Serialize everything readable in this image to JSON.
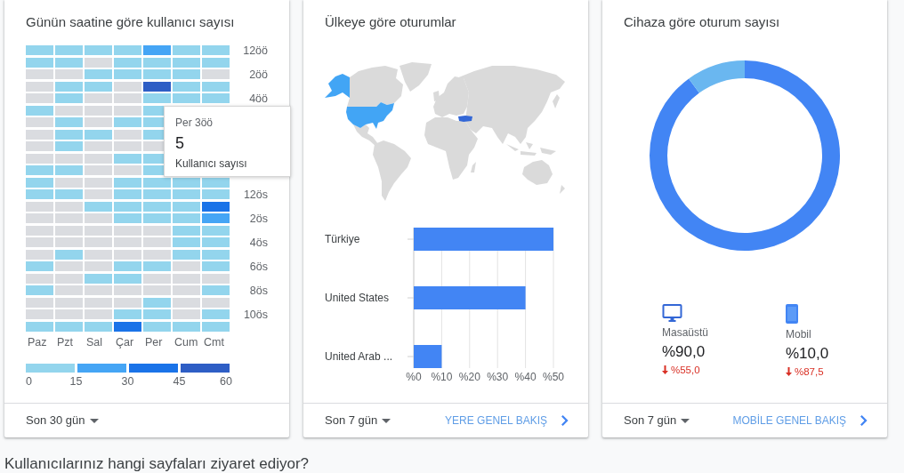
{
  "hourly_users": {
    "title": "Günün saatine göre kullanıcı sayısı",
    "rows": [
      {
        "label": "12öö",
        "cells": [
          {
            "kind": "low"
          },
          {
            "kind": "low"
          },
          {
            "kind": "low"
          },
          {
            "kind": "low"
          },
          {
            "kind": "mid"
          },
          {
            "kind": "low"
          },
          {
            "kind": "low"
          }
        ]
      },
      {
        "cells": [
          {
            "kind": "low"
          },
          {
            "kind": "low"
          },
          {
            "kind": "zero"
          },
          {
            "kind": "low"
          },
          {
            "kind": "low"
          },
          {
            "kind": "low"
          },
          {
            "kind": "low"
          }
        ]
      },
      {
        "label": "2öö",
        "cells": [
          {
            "kind": "zero"
          },
          {
            "kind": "zero"
          },
          {
            "kind": "low"
          },
          {
            "kind": "low"
          },
          {
            "kind": "low"
          },
          {
            "kind": "low"
          },
          {
            "kind": "zero"
          }
        ]
      },
      {
        "cells": [
          {
            "kind": "zero"
          },
          {
            "kind": "low"
          },
          {
            "kind": "low"
          },
          {
            "kind": "zero"
          },
          {
            "kind": "top"
          },
          {
            "kind": "low"
          },
          {
            "kind": "low"
          }
        ]
      },
      {
        "label": "4öö",
        "cells": [
          {
            "kind": "zero"
          },
          {
            "kind": "low"
          },
          {
            "kind": "zero"
          },
          {
            "kind": "zero"
          },
          {
            "kind": "low"
          },
          {
            "kind": "low"
          },
          {
            "kind": "low"
          }
        ]
      },
      {
        "cells": [
          {
            "kind": "low"
          },
          {
            "kind": "zero"
          },
          {
            "kind": "zero"
          },
          {
            "kind": "zero"
          },
          {
            "kind": "low"
          },
          null,
          null
        ]
      },
      {
        "cells": [
          {
            "kind": "zero"
          },
          {
            "kind": "low"
          },
          {
            "kind": "zero"
          },
          {
            "kind": "low"
          },
          {
            "kind": "low"
          },
          null,
          null
        ]
      },
      {
        "cells": [
          {
            "kind": "zero"
          },
          {
            "kind": "low"
          },
          {
            "kind": "low"
          },
          {
            "kind": "zero"
          },
          {
            "kind": "low"
          },
          null,
          null
        ]
      },
      {
        "cells": [
          {
            "kind": "zero"
          },
          {
            "kind": "low"
          },
          {
            "kind": "zero"
          },
          {
            "kind": "zero"
          },
          {
            "kind": "zero"
          },
          null,
          null
        ]
      },
      {
        "cells": [
          {
            "kind": "zero"
          },
          {
            "kind": "zero"
          },
          {
            "kind": "zero"
          },
          {
            "kind": "low"
          },
          {
            "kind": "low"
          },
          null,
          null
        ]
      },
      {
        "cells": [
          {
            "kind": "low"
          },
          {
            "kind": "low"
          },
          {
            "kind": "zero"
          },
          {
            "kind": "zero"
          },
          {
            "kind": "low"
          },
          null,
          null
        ]
      },
      {
        "cells": [
          {
            "kind": "low"
          },
          {
            "kind": "zero"
          },
          {
            "kind": "zero"
          },
          {
            "kind": "low"
          },
          {
            "kind": "low"
          },
          {
            "kind": "low"
          },
          {
            "kind": "low"
          }
        ]
      },
      {
        "label": "12ös",
        "cells": [
          {
            "kind": "low"
          },
          {
            "kind": "low"
          },
          {
            "kind": "zero"
          },
          {
            "kind": "low"
          },
          {
            "kind": "low"
          },
          {
            "kind": "low"
          },
          {
            "kind": "low"
          }
        ]
      },
      {
        "cells": [
          {
            "kind": "zero"
          },
          {
            "kind": "zero"
          },
          {
            "kind": "low"
          },
          {
            "kind": "low"
          },
          {
            "kind": "low"
          },
          {
            "kind": "low"
          },
          {
            "kind": "high"
          }
        ]
      },
      {
        "label": "2ös",
        "cells": [
          {
            "kind": "zero"
          },
          {
            "kind": "zero"
          },
          {
            "kind": "zero"
          },
          {
            "kind": "low"
          },
          {
            "kind": "low"
          },
          {
            "kind": "low"
          },
          {
            "kind": "mid"
          }
        ]
      },
      {
        "cells": [
          {
            "kind": "zero"
          },
          {
            "kind": "zero"
          },
          {
            "kind": "zero"
          },
          {
            "kind": "zero"
          },
          {
            "kind": "zero"
          },
          {
            "kind": "low"
          },
          {
            "kind": "low"
          }
        ]
      },
      {
        "label": "4ös",
        "cells": [
          {
            "kind": "zero"
          },
          {
            "kind": "zero"
          },
          {
            "kind": "zero"
          },
          {
            "kind": "zero"
          },
          {
            "kind": "zero"
          },
          {
            "kind": "low"
          },
          {
            "kind": "low"
          }
        ]
      },
      {
        "cells": [
          {
            "kind": "zero"
          },
          {
            "kind": "low"
          },
          {
            "kind": "zero"
          },
          {
            "kind": "zero"
          },
          {
            "kind": "zero"
          },
          {
            "kind": "low"
          },
          {
            "kind": "low"
          }
        ]
      },
      {
        "label": "6ös",
        "cells": [
          {
            "kind": "low"
          },
          {
            "kind": "zero"
          },
          {
            "kind": "zero"
          },
          {
            "kind": "low"
          },
          {
            "kind": "low"
          },
          {
            "kind": "zero"
          },
          {
            "kind": "low"
          }
        ]
      },
      {
        "cells": [
          {
            "kind": "zero"
          },
          {
            "kind": "zero"
          },
          {
            "kind": "low"
          },
          {
            "kind": "low"
          },
          {
            "kind": "zero"
          },
          {
            "kind": "zero"
          },
          {
            "kind": "zero"
          }
        ]
      },
      {
        "label": "8ös",
        "cells": [
          {
            "kind": "low"
          },
          {
            "kind": "zero"
          },
          {
            "kind": "zero"
          },
          {
            "kind": "zero"
          },
          {
            "kind": "zero"
          },
          {
            "kind": "zero"
          },
          {
            "kind": "low"
          }
        ]
      },
      {
        "cells": [
          {
            "kind": "zero"
          },
          {
            "kind": "zero"
          },
          {
            "kind": "zero"
          },
          {
            "kind": "zero"
          },
          {
            "kind": "low"
          },
          {
            "kind": "zero"
          },
          {
            "kind": "zero"
          }
        ]
      },
      {
        "label": "10ös",
        "cells": [
          {
            "kind": "zero"
          },
          {
            "kind": "zero"
          },
          {
            "kind": "zero"
          },
          {
            "kind": "low"
          },
          {
            "kind": "low"
          },
          {
            "kind": "zero"
          },
          {
            "kind": "low"
          }
        ]
      },
      {
        "cells": [
          {
            "kind": "low"
          },
          {
            "kind": "low"
          },
          {
            "kind": "low"
          },
          {
            "kind": "high"
          },
          {
            "kind": "low"
          },
          {
            "kind": "low"
          },
          {
            "kind": "low"
          }
        ]
      }
    ],
    "days": [
      "Paz",
      "Pzt",
      "Sal",
      "Çar",
      "Per",
      "Cum",
      "Cmt"
    ],
    "legend": {
      "segments": [
        {
          "kind": "low"
        },
        {
          "kind": "mid"
        },
        {
          "kind": "high"
        },
        {
          "kind": "top"
        }
      ],
      "ticks": [
        "0",
        "15",
        "30",
        "45",
        "60"
      ]
    },
    "tooltip": {
      "title": "Per 3öö",
      "value": "5",
      "label": "Kullanıcı sayısı"
    },
    "footer": {
      "range": "Son 30 gün"
    }
  },
  "country_sessions": {
    "title": "Ülkeye göre oturumlar",
    "chart_data": {
      "type": "bar",
      "orientation": "horizontal",
      "categories": [
        "Türkiye",
        "United States",
        "United Arab ..."
      ],
      "values": [
        50,
        40,
        10
      ],
      "xlim": [
        0,
        50
      ],
      "xticks": [
        {
          "value": 0,
          "label": "%0"
        },
        {
          "value": 10,
          "label": "%10"
        },
        {
          "value": 20,
          "label": "%20"
        },
        {
          "value": 30,
          "label": "%30"
        },
        {
          "value": 40,
          "label": "%40"
        },
        {
          "value": 50,
          "label": "%50"
        }
      ],
      "grid": true
    },
    "footer": {
      "range": "Son 7 gün",
      "link": "YERE GENEL BAKIŞ"
    }
  },
  "device_sessions": {
    "title": "Cihaza göre oturum sayısı",
    "chart_data": {
      "type": "donut",
      "categories": [
        "Masaüstü",
        "Mobil"
      ],
      "values": [
        90,
        10
      ]
    },
    "devices": [
      {
        "kind": "desktop",
        "value": "%90,0",
        "change": "%55,0",
        "decreased": true
      },
      {
        "kind": "mobile",
        "value": "%10,0",
        "change": "%87,5",
        "decreased": true
      }
    ],
    "footer": {
      "range": "Son 7 gün",
      "link": "MOBİLE GENEL BAKIŞ"
    }
  },
  "section_heading": "Kullanıcılarınız hangi sayfaları ziyaret ediyor?"
}
